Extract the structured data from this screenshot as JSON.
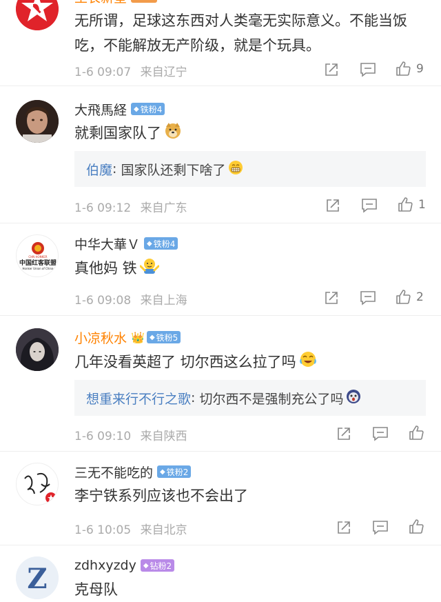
{
  "comments": [
    {
      "username": "王长新星",
      "text": "无所谓，足球这东西对人类毫无实际意义。不能当饭吃，不能解放无产阶级，就是个玩具。",
      "time": "1-6 09:07",
      "location": "来自辽宁",
      "likes": "9",
      "avatar": "hammer-sickle-star-icon"
    },
    {
      "username": "大飛馬経",
      "badge": "铁粉4",
      "text": "就剩国家队了",
      "emoji": "doge-emoji-icon",
      "quote_user": "伯魔",
      "quote_text": "国家队还剩下啥了",
      "quote_emoji": "grin-emoji-icon",
      "time": "1-6 09:12",
      "location": "来自广东",
      "likes": "1"
    },
    {
      "username": "中华大華Ｖ",
      "badge": "铁粉4",
      "avatar_text_top": "CHN HONKER",
      "avatar_text_mid": "中国红客联盟",
      "avatar_text_bot": "Honker Union of China",
      "text": "真他妈 铁",
      "emoji": "shrug-emoji-icon",
      "time": "1-6 09:08",
      "location": "来自上海",
      "likes": "2"
    },
    {
      "username": "小凉秋水",
      "badge": "铁粉5",
      "text": "几年没看英超了 切尔西这么拉了吗",
      "emoji": "crying-laughing-emoji-icon",
      "quote_user": "想重来行不行之歌",
      "quote_text": "切尔西不是强制充公了吗",
      "quote_emoji": "shocked-emoji-icon",
      "time": "1-6 09:10",
      "location": "来自陕西"
    },
    {
      "username": "三无不能吃的",
      "badge": "铁粉2",
      "text": "李宁铁系列应该也不会出了",
      "time": "1-6 10:05",
      "location": "来自北京"
    },
    {
      "username": "zdhxyzdy",
      "badge": "钻粉2",
      "text": "克母队"
    }
  ],
  "colors": {
    "username": "#333333",
    "username_vip": "#ff8200",
    "badge_iron": "#6aa8e6",
    "badge_diamond": "#b98ae8",
    "quote_name": "#4a7fc1",
    "meta": "#aaaaaa"
  }
}
